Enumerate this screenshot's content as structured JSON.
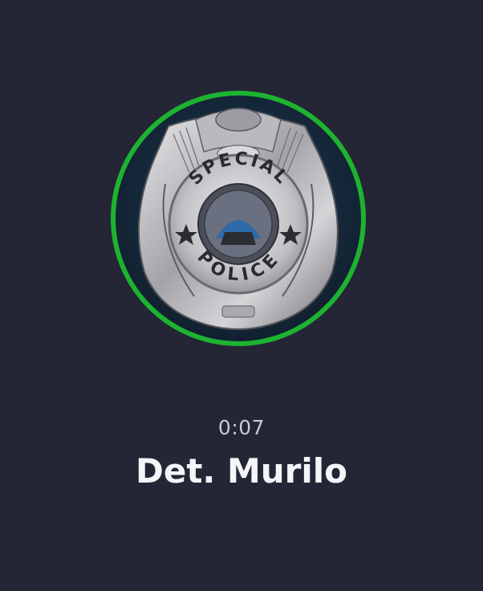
{
  "call": {
    "timer": "0:07",
    "contact_name": "Det. Murilo",
    "avatar": {
      "icon": "police-badge-icon",
      "badge_top_text": "SPECIAL",
      "badge_bottom_text": "POLICE"
    }
  },
  "colors": {
    "background": "#242535",
    "ring": "#1db331",
    "timer_text": "#c9cbd3",
    "name_text": "#f4f5f8"
  }
}
